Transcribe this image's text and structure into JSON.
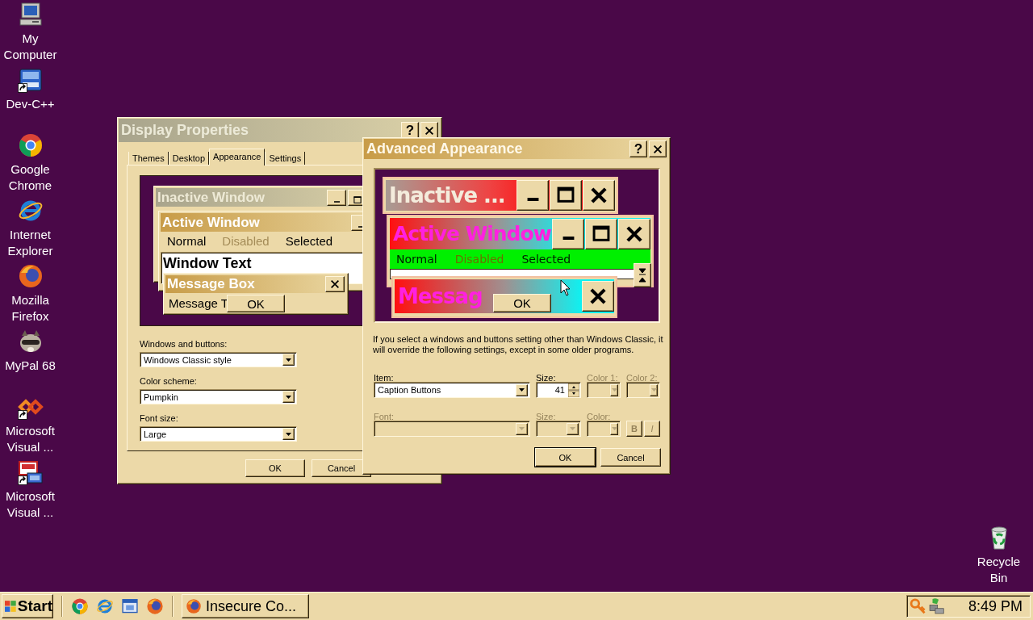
{
  "desktop_icons": [
    {
      "label": "My Computer",
      "kind": "computer",
      "shortcut": false
    },
    {
      "label": "Dev-C++",
      "kind": "dev",
      "shortcut": true
    },
    {
      "label": "Google Chrome",
      "kind": "chrome",
      "shortcut": false
    },
    {
      "label": "Internet Explorer",
      "kind": "ie",
      "shortcut": false
    },
    {
      "label": "Mozilla Firefox",
      "kind": "firefox",
      "shortcut": false
    },
    {
      "label": "MyPal 68",
      "kind": "mypal",
      "shortcut": false
    },
    {
      "label": "Microsoft Visual ...",
      "kind": "vs",
      "shortcut": true
    },
    {
      "label": "Microsoft Visual ...",
      "kind": "vj",
      "shortcut": true
    }
  ],
  "recycle_bin": {
    "label": "Recycle Bin",
    "kind": "recycle"
  },
  "display_properties": {
    "title": "Display Properties",
    "active": false,
    "help": "?",
    "tabs": [
      {
        "label": "Themes",
        "selected": false
      },
      {
        "label": "Desktop",
        "selected": false
      },
      {
        "label": "Appearance",
        "selected": true
      },
      {
        "label": "Settings",
        "selected": false
      }
    ],
    "preview": {
      "inactive_title": "Inactive Window",
      "active_title": "Active Window",
      "menu": [
        {
          "label": "Normal",
          "disabled": false
        },
        {
          "label": "Disabled",
          "disabled": true
        },
        {
          "label": "Selected",
          "disabled": false
        }
      ],
      "window_text": "Window Text",
      "message_title": "Message Box",
      "message_text": "Message T",
      "ok": "OK"
    },
    "fields": [
      {
        "label": "Windows and buttons:",
        "value": "Windows Classic style"
      },
      {
        "label": "Color scheme:",
        "value": "Pumpkin"
      },
      {
        "label": "Font size:",
        "value": "Large"
      }
    ],
    "buttons": [
      "OK",
      "Cancel"
    ]
  },
  "advanced_appearance": {
    "title": "Advanced Appearance",
    "active": true,
    "help": "?",
    "preview": {
      "inactive_title": "Inactive ...",
      "active_title": "Active Window",
      "menu": [
        {
          "label": "Normal",
          "disabled": false
        },
        {
          "label": "Disabled",
          "disabled": true
        },
        {
          "label": "Selected",
          "disabled": false
        }
      ],
      "message_title": "Messag",
      "ok": "OK"
    },
    "note": "If you select a windows and buttons setting other than Windows Classic, it will override the following settings, except in some older programs.",
    "rows": [
      [
        {
          "kind": "combo",
          "label": "Item:",
          "value": "Caption Buttons",
          "disabled": false
        },
        {
          "kind": "spin",
          "label": "Size:",
          "value": "41",
          "disabled": false
        },
        {
          "kind": "color",
          "label": "Color 1:",
          "disabled": true
        },
        {
          "kind": "color",
          "label": "Color 2:",
          "disabled": true
        }
      ],
      [
        {
          "kind": "combo",
          "label": "Font:",
          "disabled": true
        },
        {
          "kind": "combo",
          "label": "Size:",
          "disabled": true
        },
        {
          "kind": "color",
          "label": "Color:",
          "disabled": true
        },
        {
          "kind": "styles",
          "buttons": [
            {
              "label": "B",
              "kind": "bold",
              "disabled": true
            },
            {
              "label": "I",
              "kind": "italic",
              "disabled": true
            }
          ]
        }
      ]
    ],
    "buttons": [
      "OK",
      "Cancel"
    ]
  },
  "taskbar": {
    "start": "Start",
    "quick_launch": [
      {
        "kind": "chrome"
      },
      {
        "kind": "ie"
      },
      {
        "kind": "showdesktop"
      },
      {
        "kind": "firefox"
      }
    ],
    "tasks": [
      {
        "label": "Insecure Co...",
        "kind": "firefox"
      }
    ],
    "tray": [
      {
        "kind": "key"
      },
      {
        "kind": "network"
      }
    ],
    "clock": "8:49 PM"
  }
}
